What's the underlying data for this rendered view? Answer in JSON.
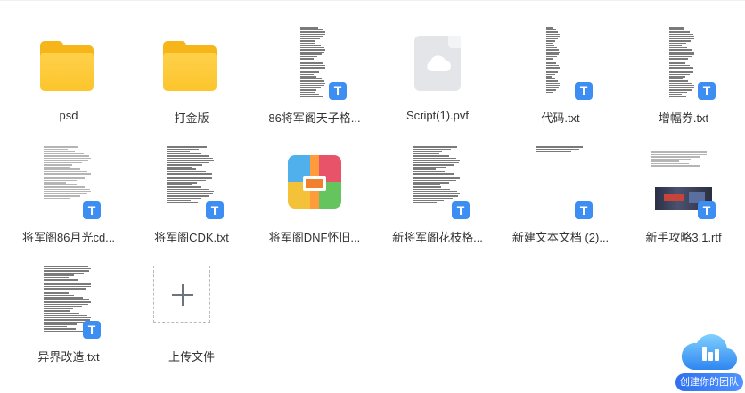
{
  "files": {
    "row1": [
      {
        "name": "psd",
        "icon": "folder-icon"
      },
      {
        "name": "打金版",
        "icon": "folder-icon"
      },
      {
        "name": "86将军阁天子格...",
        "icon": "txt-file-icon"
      },
      {
        "name": "Script(1).pvf",
        "icon": "generic-file-icon"
      },
      {
        "name": "代码.txt",
        "icon": "txt-file-icon"
      },
      {
        "name": "增幅券.txt",
        "icon": "txt-file-icon"
      }
    ],
    "row2": [
      {
        "name": "将军阁86月光cd...",
        "icon": "txt-file-icon"
      },
      {
        "name": "将军阁CDK.txt",
        "icon": "txt-file-icon"
      },
      {
        "name": "将军阁DNF怀旧...",
        "icon": "archive-icon"
      },
      {
        "name": "新将军阁花枝格...",
        "icon": "txt-file-icon"
      },
      {
        "name": "新建文本文档 (2)...",
        "icon": "txt-file-icon"
      },
      {
        "name": "新手攻略3.1.rtf",
        "icon": "rtf-file-icon"
      }
    ],
    "row3": [
      {
        "name": "异界改造.txt",
        "icon": "txt-file-icon"
      }
    ]
  },
  "upload": {
    "label": "上传文件"
  },
  "badge": {
    "txt": "T"
  },
  "team": {
    "label": "创建你的团队"
  },
  "colors": {
    "accent": "#3d8ef3",
    "folder": "#fcc52c"
  }
}
